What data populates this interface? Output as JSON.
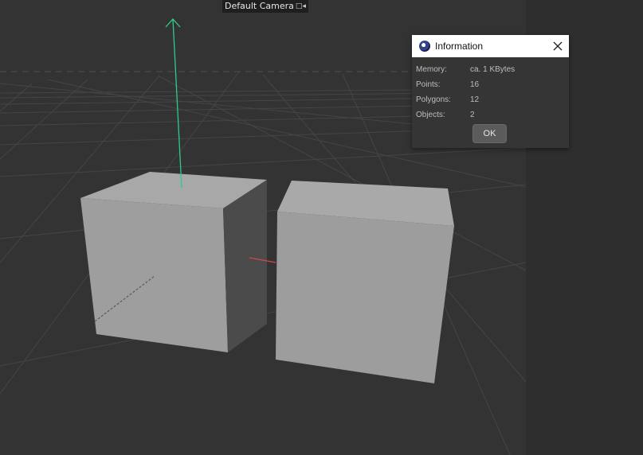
{
  "viewport": {
    "camera_label": "Default Camera",
    "camera_icon": "camera-icon"
  },
  "info_dialog": {
    "title": "Information",
    "app_icon": "cinema4d-logo-icon",
    "close_icon": "close-icon",
    "rows": [
      {
        "label": "Memory:",
        "value": "ca. 1 KBytes"
      },
      {
        "label": "Points:",
        "value": "16"
      },
      {
        "label": "Polygons:",
        "value": "12"
      },
      {
        "label": "Objects:",
        "value": "2"
      }
    ],
    "ok_label": "OK"
  },
  "colors": {
    "viewport_bg": "#333333",
    "grid_line": "#4a4a4a",
    "cube_face_front": "#9d9d9d",
    "cube_face_top": "#a9a9a9",
    "cube_face_side": "#4b4b4b",
    "axis_y": "#2ecc8a",
    "axis_x": "#d04848"
  }
}
